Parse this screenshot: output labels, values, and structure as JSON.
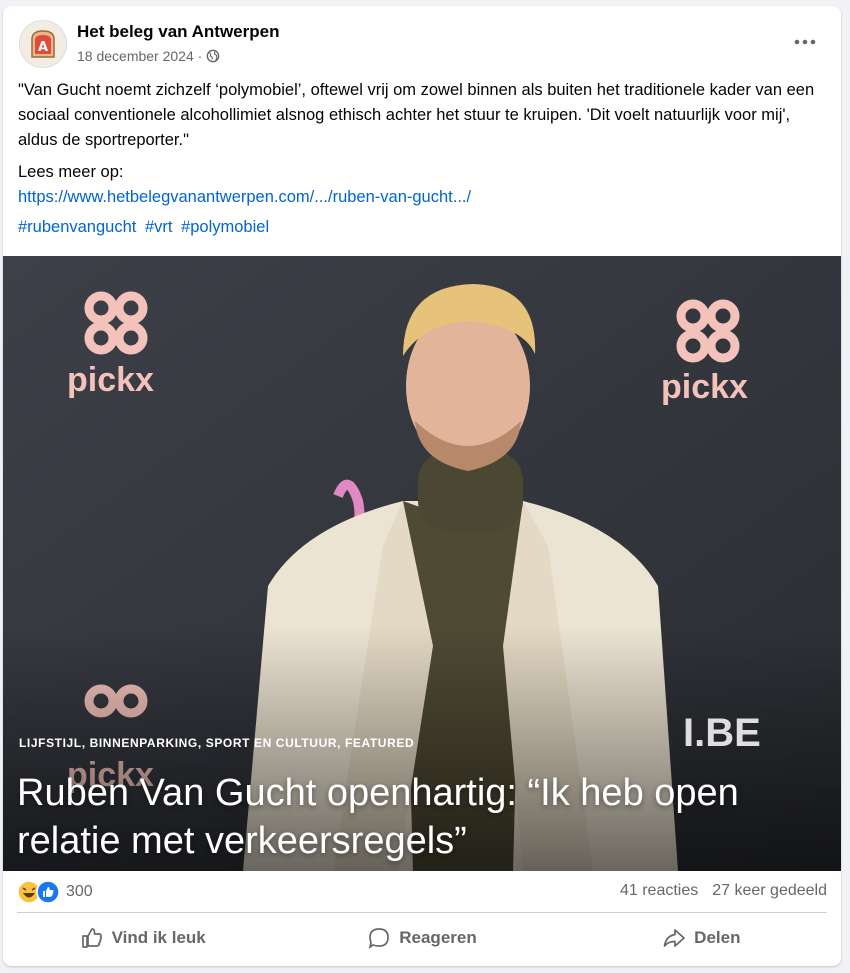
{
  "post": {
    "page_name": "Het beleg van Antwerpen",
    "date": "18 december 2024 · ",
    "text": "\"Van Gucht noemt zichzelf ‘polymobiel’, oftewel vrij om zowel binnen als buiten het traditionele kader van een sociaal conventionele alcohollimiet alsnog ethisch achter het stuur te kruipen. 'Dit voelt natuurlijk voor mij', aldus de sportreporter.\"",
    "read_more_label": "Lees meer op:",
    "link": "https://www.hetbelegvanantwerpen.com/.../ruben-van-gucht.../",
    "hashtags": [
      "#rubenvangucht",
      "#vrt",
      "#polymobiel"
    ]
  },
  "image": {
    "categories": "LIJFSTIJL,  BINNENPARKING,  SPORT EN CULTUUR,  FEATURED",
    "headline": "Ruben Van Gucht openhartig: “Ik heb open relatie met verkeersregels”",
    "backdrop_logo": "pickx",
    "backdrop_text": "I.BE"
  },
  "stats": {
    "reaction_count": "300",
    "comments": "41 reacties",
    "shares": "27 keer gedeeld"
  },
  "actions": {
    "like": "Vind ik leuk",
    "comment": "Reageren",
    "share": "Delen"
  },
  "colors": {
    "link": "#0064d1",
    "like_blue": "#1877f2",
    "muted": "#65676b"
  }
}
